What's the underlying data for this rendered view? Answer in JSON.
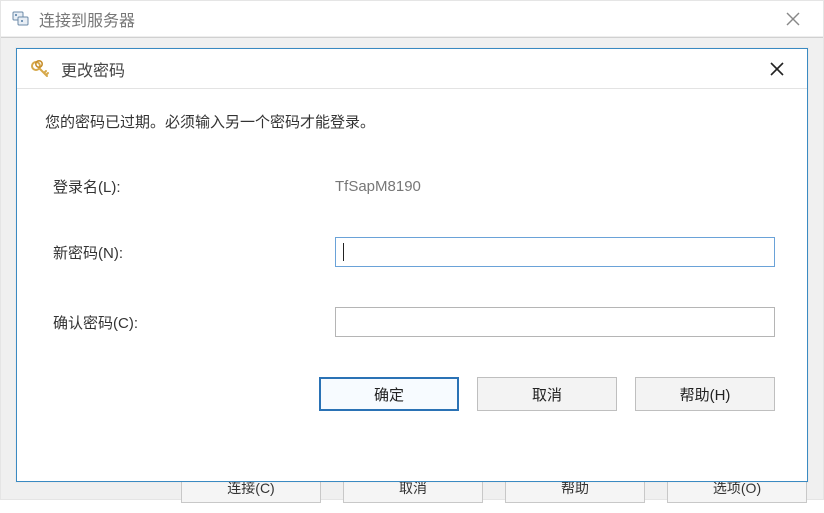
{
  "parent_window": {
    "title": "连接到服务器",
    "bottom_buttons": [
      "连接(C)",
      "取消",
      "帮助",
      "选项(O)"
    ]
  },
  "dialog": {
    "title": "更改密码",
    "message": "您的密码已过期。必须输入另一个密码才能登录。",
    "fields": {
      "login_label": "登录名(L):",
      "login_value": "TfSapM8190",
      "new_password_label": "新密码(N):",
      "new_password_value": "",
      "confirm_password_label": "确认密码(C):",
      "confirm_password_value": ""
    },
    "buttons": {
      "ok": "确定",
      "cancel": "取消",
      "help": "帮助(H)"
    }
  }
}
